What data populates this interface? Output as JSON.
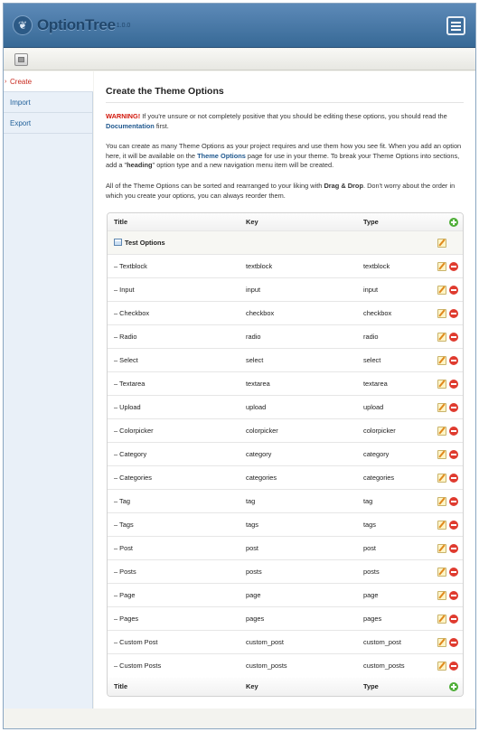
{
  "app": {
    "name": "OptionTree",
    "version": "1.0.0"
  },
  "nav": {
    "items": [
      {
        "label": "Create",
        "active": true
      },
      {
        "label": "Import",
        "active": false
      },
      {
        "label": "Export",
        "active": false
      }
    ]
  },
  "main": {
    "title": "Create the Theme Options",
    "p1": {
      "warning": "WARNING!",
      "text_a": " If you're unsure or not completely positive that you should be editing these options, you should read the ",
      "link": "Documentation",
      "text_b": " first."
    },
    "p2": {
      "text_a": "You can create as many Theme Options as your project requires and use them how you see fit. When you add an option here, it will be available on the ",
      "link": "Theme Options",
      "text_b": " page for use in your theme. To break your Theme Options into sections, add a \"",
      "strong": "heading",
      "text_c": "\" option type and a new navigation menu item will be created."
    },
    "p3": {
      "text_a": "All of the Theme Options can be sorted and rearranged to your liking with ",
      "strong": "Drag & Drop",
      "text_b": ". Don't worry about the order in which you create your options, you can always reorder them."
    }
  },
  "table": {
    "columns": {
      "title": "Title",
      "key": "Key",
      "type": "Type"
    },
    "heading_row": "Test Options",
    "rows": [
      {
        "title": "– Textblock",
        "key": "textblock",
        "type": "textblock"
      },
      {
        "title": "– Input",
        "key": "input",
        "type": "input"
      },
      {
        "title": "– Checkbox",
        "key": "checkbox",
        "type": "checkbox"
      },
      {
        "title": "– Radio",
        "key": "radio",
        "type": "radio"
      },
      {
        "title": "– Select",
        "key": "select",
        "type": "select"
      },
      {
        "title": "– Textarea",
        "key": "textarea",
        "type": "textarea"
      },
      {
        "title": "– Upload",
        "key": "upload",
        "type": "upload"
      },
      {
        "title": "– Colorpicker",
        "key": "colorpicker",
        "type": "colorpicker"
      },
      {
        "title": "– Category",
        "key": "category",
        "type": "category"
      },
      {
        "title": "– Categories",
        "key": "categories",
        "type": "categories"
      },
      {
        "title": "– Tag",
        "key": "tag",
        "type": "tag"
      },
      {
        "title": "– Tags",
        "key": "tags",
        "type": "tags"
      },
      {
        "title": "– Post",
        "key": "post",
        "type": "post"
      },
      {
        "title": "– Posts",
        "key": "posts",
        "type": "posts"
      },
      {
        "title": "– Page",
        "key": "page",
        "type": "page"
      },
      {
        "title": "– Pages",
        "key": "pages",
        "type": "pages"
      },
      {
        "title": "– Custom Post",
        "key": "custom_post",
        "type": "custom_post"
      },
      {
        "title": "– Custom Posts",
        "key": "custom_posts",
        "type": "custom_posts"
      }
    ]
  },
  "icons": {
    "logo": "optiontree-leaf-icon",
    "header_button": "options-sliders-icon",
    "toolbar": "screen-options-icon",
    "heading": "window-section-icon",
    "edit": "pencil-edit-icon",
    "delete": "red-minus-delete-icon",
    "add": "green-plus-add-icon"
  },
  "colors": {
    "header": "#376996",
    "nav_active": "#c7291e",
    "link": "#21598f",
    "warning": "#d2160a",
    "sidebar": "#e9f0f8"
  }
}
